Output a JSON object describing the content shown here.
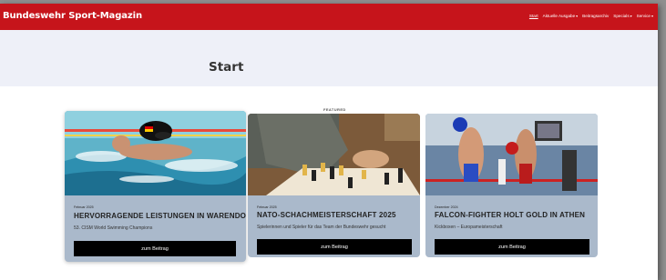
{
  "header": {
    "brand": "Bundeswehr Sport-Magazin",
    "nav": [
      {
        "label": "Start",
        "active": true,
        "has_caret": false
      },
      {
        "label": "Aktuelle Ausgabe",
        "active": false,
        "has_caret": true
      },
      {
        "label": "Beitragsarchiv",
        "active": false,
        "has_caret": false
      },
      {
        "label": "Specials",
        "active": false,
        "has_caret": true
      },
      {
        "label": "Service",
        "active": false,
        "has_caret": true
      }
    ]
  },
  "hero": {
    "title": "Start"
  },
  "featured_label": "FEATURED",
  "cards": [
    {
      "date": "Februar 2025",
      "title": "HERVORRAGENDE LEISTUNGEN IN WARENDORF",
      "subtitle": "53. CISM World Swimming Champions",
      "button": "zum Beitrag",
      "image": "swimmer-photo"
    },
    {
      "date": "Februar 2025",
      "title": "NATO-SCHACHMEISTERSCHAFT 2025",
      "subtitle": "Spielerinnen und Spieler für das Team der Bundeswehr gesucht",
      "button": "zum Beitrag",
      "image": "chess-photo"
    },
    {
      "date": "Dezember 2024",
      "title": "FALCON-FIGHTER HOLT GOLD IN ATHEN",
      "subtitle": "Kickboxen – Europameisterschaft",
      "button": "zum Beitrag",
      "image": "kickboxing-photo"
    }
  ],
  "colors": {
    "brand_red": "#c6141b",
    "hero_bg": "#eef0f8",
    "card_bg": "#aab9cb",
    "button_bg": "#000000"
  }
}
